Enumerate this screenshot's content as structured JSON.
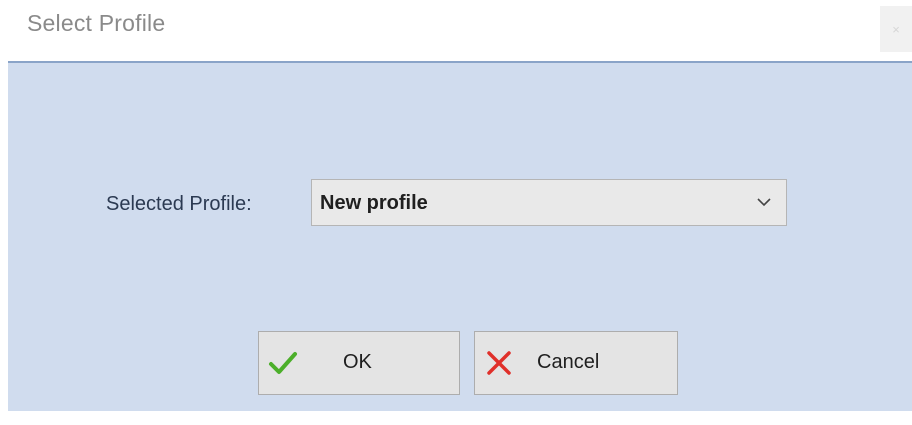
{
  "window": {
    "title": "Select Profile",
    "close_glyph": "×"
  },
  "form": {
    "profile_label": "Selected Profile:",
    "profile_value": "New profile",
    "dropdown_icon": "chevron-down-icon"
  },
  "buttons": {
    "ok": {
      "label": "OK",
      "icon": "checkmark-icon",
      "icon_color": "#4caf2a"
    },
    "cancel": {
      "label": "Cancel",
      "icon": "x-icon",
      "icon_color": "#e0302a"
    }
  },
  "colors": {
    "client_background": "#d0dcee",
    "separator": "#8aa4c8",
    "title_text": "#8a8a8a"
  }
}
